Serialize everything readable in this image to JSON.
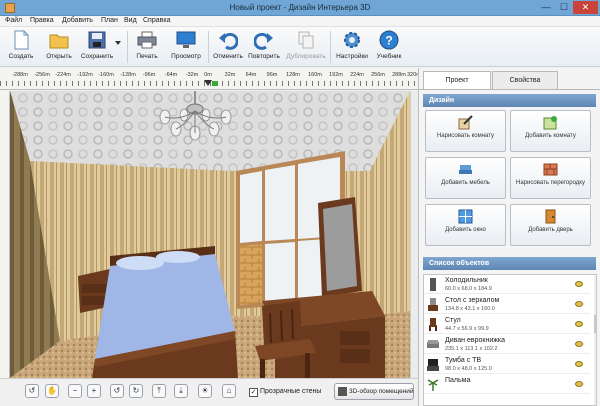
{
  "window": {
    "title": "Новый проект - Дизайн Интерьера 3D",
    "minimize": "—",
    "maximize": "☐",
    "close": "✕"
  },
  "menu": [
    "Файл",
    "Правка",
    "Добавить",
    "План",
    "Вид",
    "Справка"
  ],
  "toolbar": {
    "create": "Создать",
    "open": "Открыть",
    "save": "Сохранить",
    "print": "Печать",
    "preview": "Просмотр",
    "undo": "Отменить",
    "redo": "Повторить",
    "duplicate": "Дублировать",
    "settings": "Настройки",
    "tutorial": "Учебник"
  },
  "ruler": [
    "-288m",
    "-256m",
    "-224m",
    "-192m",
    "-160m",
    "-128m",
    "-96m",
    "-64m",
    "-32m",
    "0m",
    "32m",
    "64m",
    "96m",
    "128m",
    "160m",
    "192m",
    "224m",
    "256m",
    "288m",
    "320m"
  ],
  "bottom": {
    "undo_zoom": "↺",
    "pan": "✋",
    "zoom_out": "−",
    "zoom_in": "+",
    "rot_left": "↺",
    "rot_right": "↻",
    "tilt_up": "⤒",
    "tilt_down": "⤓",
    "light": "☀",
    "home": "⌂",
    "check": "✓",
    "transparent_walls": "Прозрачные стены",
    "overview": "3D-обзор помещений"
  },
  "panel": {
    "tab_project": "Проект",
    "tab_properties": "Свойства",
    "design_header": "Дизайн",
    "design_buttons": [
      "Нарисовать комнату",
      "Добавить комнату",
      "Добавить мебель",
      "Нарисовать перегородку",
      "Добавить окно",
      "Добавить дверь"
    ],
    "objects_header": "Список объектов",
    "objects": [
      {
        "name": "Холодильник",
        "dims": "60.0 x 68.0 x 184.9"
      },
      {
        "name": "Стол с зеркалом",
        "dims": "134.8 x 43.1 x 160.0"
      },
      {
        "name": "Стул",
        "dims": "44.7 x 56.9 x 99.9"
      },
      {
        "name": "Диван еврокнижка",
        "dims": "235.1 x 113.1 x 102.2"
      },
      {
        "name": "Тумба с ТВ",
        "dims": "98.0 x 48.0 x 125.0"
      },
      {
        "name": "Пальма",
        "dims": ""
      }
    ]
  },
  "colors": {
    "titlebar": "#6fa6d6",
    "panel_header": "#5d86b3",
    "wall_stripe": "#c4a878",
    "bed_sheet": "#9fb6e6",
    "wood": "#6b3a1e"
  }
}
